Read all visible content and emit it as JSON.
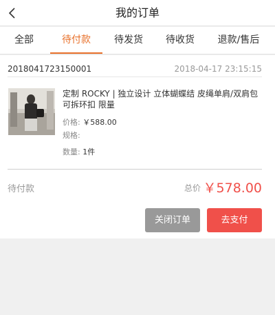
{
  "header": {
    "title": "我的订单",
    "back_icon": "chevron-left-icon"
  },
  "tabs": [
    {
      "label": "全部",
      "active": false
    },
    {
      "label": "待付款",
      "active": true
    },
    {
      "label": "待发货",
      "active": false
    },
    {
      "label": "待收货",
      "active": false
    },
    {
      "label": "退款/售后",
      "active": false
    }
  ],
  "order": {
    "number": "2018041723150001",
    "time": "2018-04-17 23:15:15",
    "product": {
      "title": "定制 ROCKY | 独立设计 立体蝴蝶结 皮绳单肩/双肩包 可拆环扣 限量",
      "price_label": "价格:",
      "price_value": "￥588.00",
      "spec_label": "规格:",
      "spec_value": "",
      "qty_label": "数量:",
      "qty_value": "1件"
    },
    "status": "待付款",
    "total_label": "总价",
    "total_value": "￥578.00",
    "buttons": {
      "close": "关闭订单",
      "pay": "去支付"
    }
  },
  "colors": {
    "accent": "#e8702a",
    "price_red": "#f0504a",
    "close_gray": "#999999"
  }
}
